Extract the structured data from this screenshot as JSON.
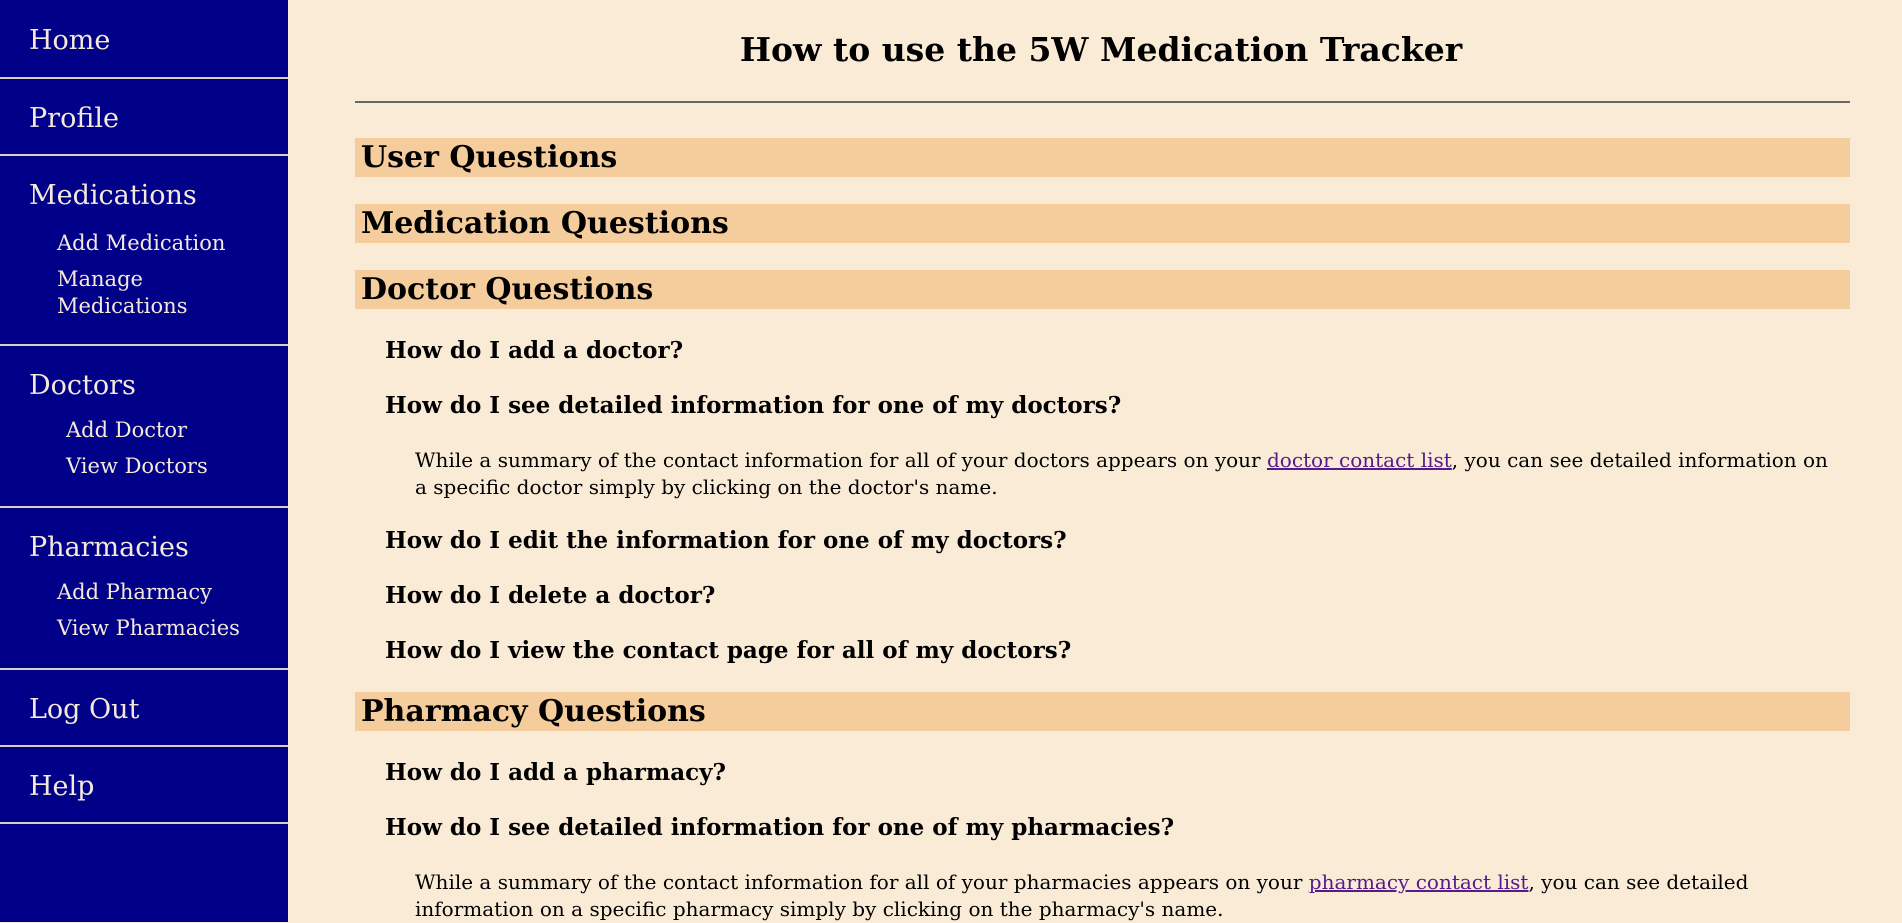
{
  "sidebar": {
    "home": "Home",
    "profile": "Profile",
    "medications": {
      "label": "Medications",
      "items": [
        "Add Medication",
        "Manage Medications"
      ]
    },
    "doctors": {
      "label": "Doctors",
      "items": [
        "Add Doctor",
        "View Doctors"
      ]
    },
    "pharmacies": {
      "label": "Pharmacies",
      "items": [
        "Add Pharmacy",
        "View Pharmacies"
      ]
    },
    "logout": "Log Out",
    "help": "Help"
  },
  "main": {
    "title": "How to use the 5W Medication Tracker",
    "sections": [
      {
        "heading": "User Questions"
      },
      {
        "heading": "Medication Questions"
      },
      {
        "heading": "Doctor Questions",
        "questions": [
          "How do I add a doctor?",
          "How do I see detailed information for one of my doctors?",
          "How do I edit the information for one of my doctors?",
          "How do I delete a doctor?",
          "How do I view the contact page for all of my doctors?"
        ],
        "answer": {
          "before": "While a summary of the contact information for all of your doctors appears on your ",
          "link": "doctor contact list",
          "after": ", you can see detailed information on a specific doctor simply by clicking on the doctor's name."
        }
      },
      {
        "heading": "Pharmacy Questions",
        "questions": [
          "How do I add a pharmacy?",
          "How do I see detailed information for one of my pharmacies?"
        ],
        "answer": {
          "before": "While a summary of the contact information for all of your pharmacies appears on your ",
          "link": "pharmacy contact list",
          "after": ", you can see detailed information on a specific pharmacy simply by clicking on the pharmacy's name."
        }
      }
    ]
  },
  "colors": {
    "sidebar_bg": "#000088",
    "sidebar_text": "#f5e9dc",
    "page_bg": "#faebd7",
    "section_bar": "#f5cd9c",
    "link": "#551a8b"
  }
}
